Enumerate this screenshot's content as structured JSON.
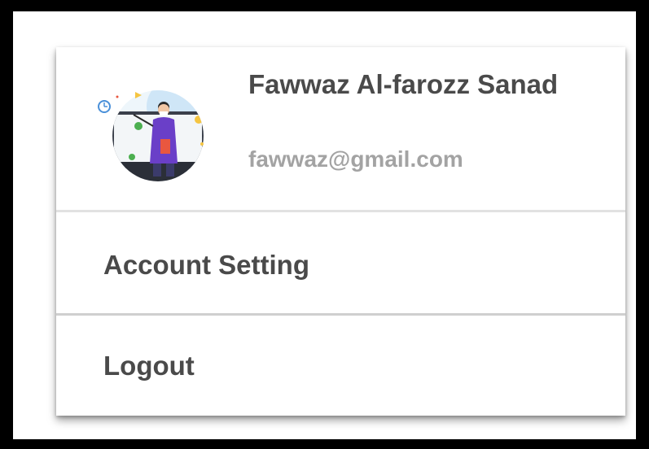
{
  "profile": {
    "name": "Fawwaz Al-farozz Sanad",
    "email": "fawwaz@gmail.com",
    "avatar_icon": "teacher-illustration-avatar"
  },
  "menu": {
    "items": [
      {
        "label": "Account Setting",
        "icon": ""
      },
      {
        "label": "Logout",
        "icon": ""
      }
    ]
  },
  "colors": {
    "text_primary": "#4a4a4a",
    "text_secondary": "#a3a3a3",
    "divider": "#d9d9d9",
    "avatar_accent": "#6a3fc8"
  }
}
